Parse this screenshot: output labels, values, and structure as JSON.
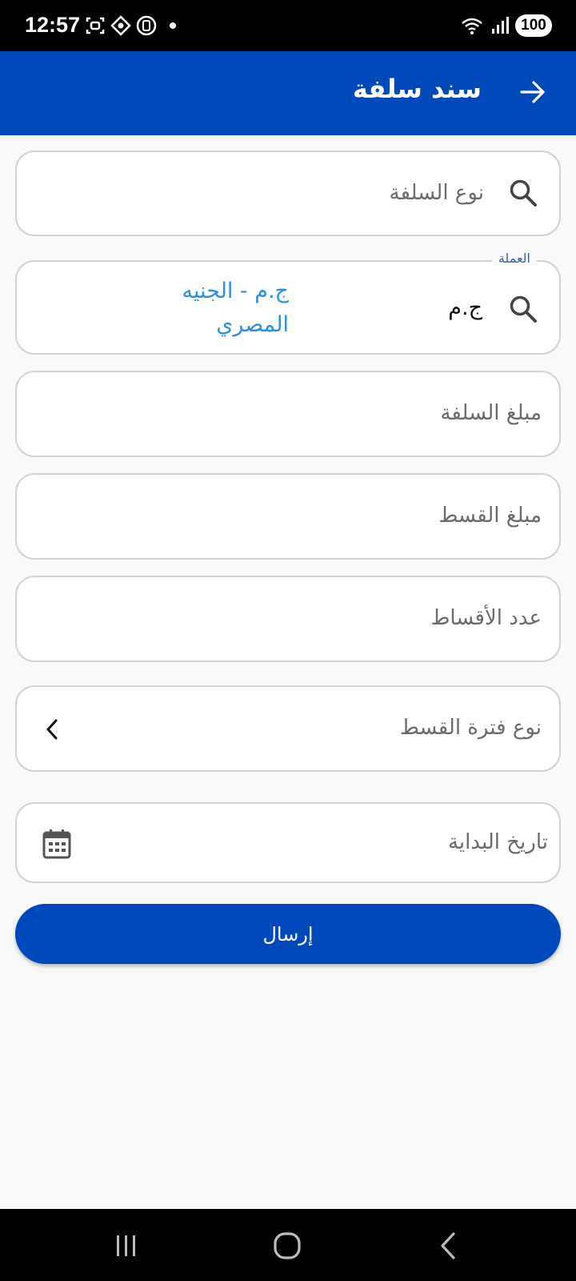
{
  "status_bar": {
    "time": "12:57",
    "battery": "100",
    "icons": [
      "screenshot-icon",
      "app-icon",
      "app-icon",
      "dot",
      "wifi-icon",
      "signal-icon",
      "battery-icon"
    ]
  },
  "header": {
    "title": "سند سلفة",
    "back_icon": "arrow-right-icon"
  },
  "form": {
    "advance_type": {
      "placeholder": "نوع السلفة"
    },
    "currency": {
      "label": "العملة",
      "code": "ج.م",
      "name": "ج.م - الجنيه المصري"
    },
    "advance_amount": {
      "placeholder": "مبلغ السلفة"
    },
    "installment_amount": {
      "placeholder": "مبلغ القسط"
    },
    "installments_count": {
      "placeholder": "عدد الأقساط"
    },
    "installment_period_type": {
      "placeholder": "نوع فترة القسط"
    },
    "start_date": {
      "placeholder": "تاريخ البداية"
    },
    "submit_label": "إرسال"
  },
  "colors": {
    "primary": "#0049bb",
    "link": "#2f8fdc",
    "border": "#d2d3da"
  }
}
